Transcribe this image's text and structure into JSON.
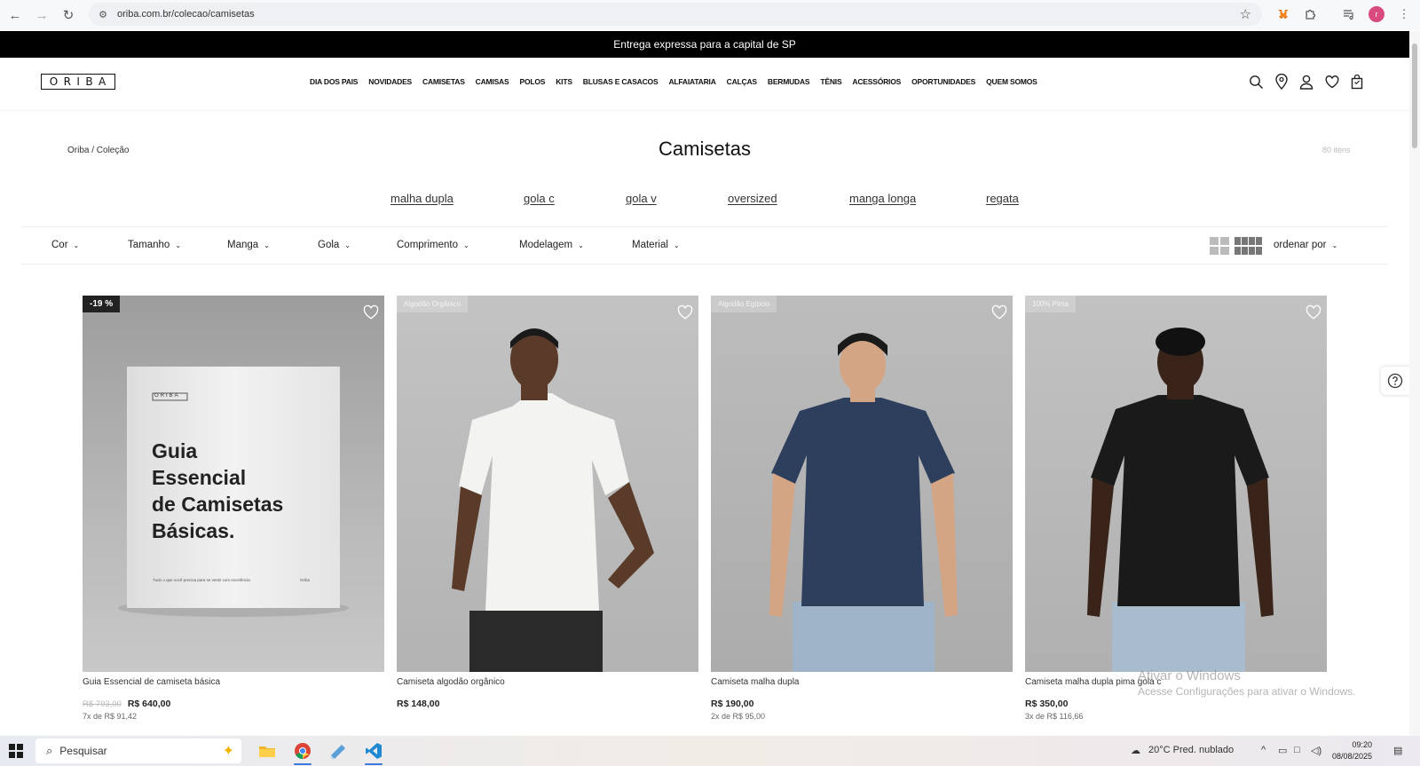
{
  "browser": {
    "url": "oriba.com.br/colecao/camisetas",
    "profile_initial": "r"
  },
  "banner": {
    "text": "Entrega expressa para a capital de SP"
  },
  "header": {
    "logo_letters": [
      "O",
      "R",
      "I",
      "B",
      "A"
    ],
    "nav": [
      "DIA DOS PAIS",
      "NOVIDADES",
      "CAMISETAS",
      "CAMISAS",
      "POLOS",
      "KITS",
      "BLUSAS E CASACOS",
      "ALFAIATARIA",
      "CALÇAS",
      "BERMUDAS",
      "TÊNIS",
      "ACESSÓRIOS",
      "OPORTUNIDADES",
      "QUEM SOMOS"
    ],
    "icons": [
      "search-icon",
      "location-pin-icon",
      "user-icon",
      "heart-icon",
      "shopping-bag-icon"
    ]
  },
  "page": {
    "breadcrumb": "Oriba / Coleção",
    "title": "Camisetas",
    "item_count": "80 itens"
  },
  "quick_links": [
    "malha dupla",
    "gola c",
    "gola v",
    "oversized",
    "manga longa",
    "regata"
  ],
  "filters": [
    "Cor",
    "Tamanho",
    "Manga",
    "Gola",
    "Comprimento",
    "Modelagem",
    "Material"
  ],
  "sort_label": "ordenar por",
  "products": [
    {
      "badge": "-19 %",
      "name": "Guia Essencial de camiseta básica",
      "old_price": "R$ 793,00",
      "price": "R$ 640,00",
      "installments": "7x de R$ 91,42",
      "book": {
        "logo": "ORIBA",
        "title_lines": [
          "Guia",
          "Essencial",
          "de Camisetas",
          "Básicas."
        ],
        "tagline": "Tudo o que você precisa para se vestir com excelência.",
        "corner": "Oriba"
      }
    },
    {
      "badge": "Algodão Orgânico",
      "name": "Camiseta algodão orgânico",
      "old_price": "",
      "price": "R$ 148,00",
      "installments": ""
    },
    {
      "badge": "Algodão Egípcio",
      "name": "Camiseta malha dupla",
      "old_price": "",
      "price": "R$ 190,00",
      "installments": "2x de R$ 95,00"
    },
    {
      "badge": "100% Pima",
      "name": "Camiseta malha dupla pima gola c",
      "old_price": "",
      "price": "R$ 350,00",
      "installments": "3x de R$ 116,66"
    }
  ],
  "watermark": {
    "line1": "Ativar o Windows",
    "line2": "Acesse Configurações para ativar o Windows."
  },
  "taskbar": {
    "search_placeholder": "Pesquisar",
    "weather": "20°C  Pred. nublado",
    "time": "09:20",
    "date": "08/08/2025"
  },
  "colors": {
    "accent": "#000000",
    "shirt_white": "#f3f3f1",
    "shirt_navy": "#2e3f5e",
    "shirt_black": "#1a1a1a"
  }
}
